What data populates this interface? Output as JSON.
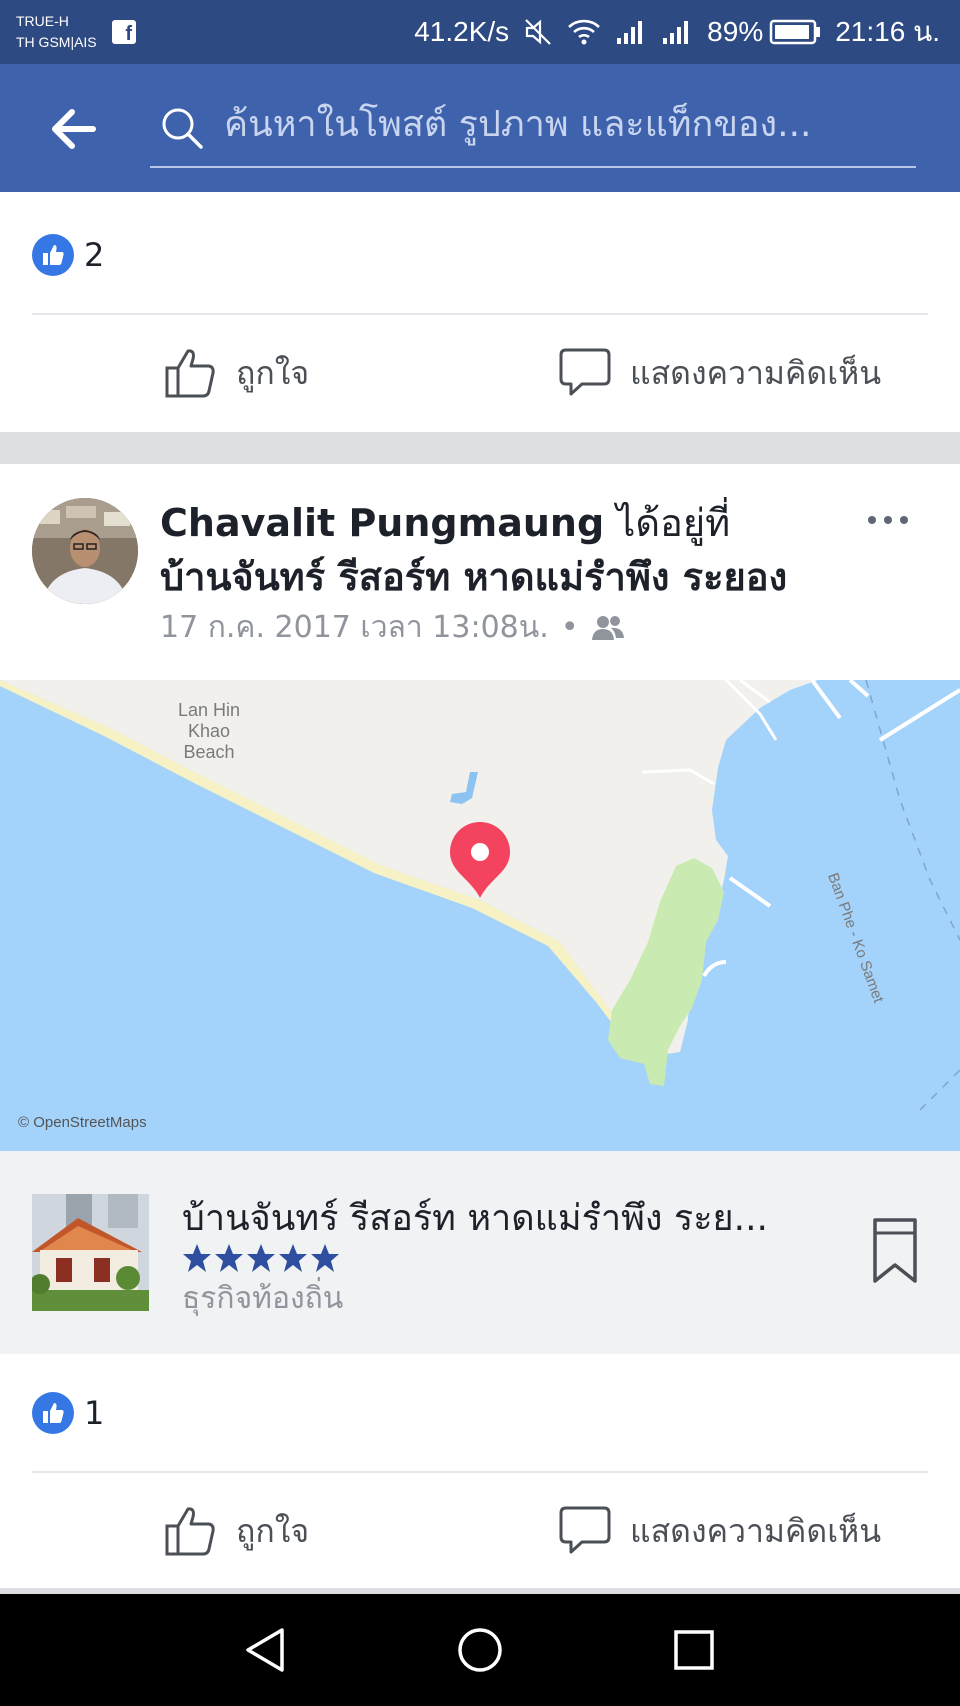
{
  "status_bar": {
    "carrier_line1": "TRUE-H",
    "carrier_line2": "TH GSM|AIS",
    "notification_icon": "facebook-icon",
    "net_speed": "41.2K/s",
    "battery": "89%",
    "time": "21:16 น."
  },
  "header": {
    "back_icon": "arrow-left-icon",
    "search_placeholder": "ค้นหาในโพสต์ รูปภาพ และแท็กของ..."
  },
  "prev_post": {
    "like_count": "2",
    "like_label": "ถูกใจ",
    "comment_label": "แสดงความคิดเห็น"
  },
  "post": {
    "author": "Chavalit Pungmaung",
    "verb": " ได้อยู่ที่ ",
    "place_bold": "บ้านจันทร์ รีสอร์ท หาดแม่รำพึง ระยอง",
    "timestamp": "17 ก.ค. 2017 เวลา 13:08น.",
    "separator": "•",
    "audience_icon": "friends-icon",
    "map": {
      "beach_label_1": "Lan Hin",
      "beach_label_2": "Khao",
      "beach_label_3": "Beach",
      "route_label": "Ban Phe - Ko Samet",
      "credit": "© OpenStreetMaps"
    },
    "place_card": {
      "name": "บ้านจันทร์ รีสอร์ท หาดแม่รำพึง ระย...",
      "rating": 5,
      "category": "ธุรกิจท้องถิ่น"
    },
    "like_count": "1",
    "like_label": "ถูกใจ",
    "comment_label": "แสดงความคิดเห็น"
  },
  "colors": {
    "header": "#3f62ad",
    "status_bar": "#2e4a82",
    "like_blue": "#3578e5",
    "map_water": "#a3d2fb",
    "map_land": "#f1f0ec",
    "map_park": "#c9ebb1",
    "pin": "#f3435f",
    "stars": "#2f4f9e"
  }
}
